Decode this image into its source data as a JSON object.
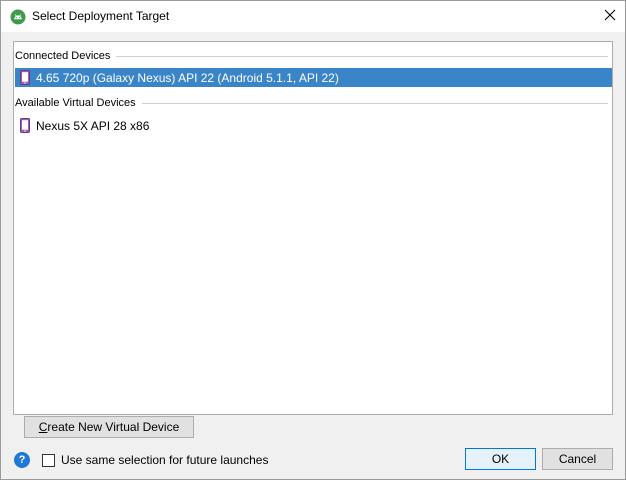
{
  "window": {
    "title": "Select Deployment Target",
    "app_icon": "android-studio-icon",
    "close_icon": "close-icon"
  },
  "device_list": {
    "sections": [
      {
        "header": "Connected Devices",
        "devices": [
          {
            "label": "4.65  720p (Galaxy Nexus) API 22 (Android 5.1.1, API 22)",
            "icon": "phone-icon",
            "selected": true
          }
        ]
      },
      {
        "header": "Available Virtual Devices",
        "devices": [
          {
            "label": "Nexus 5X API 28 x86",
            "icon": "phone-icon",
            "selected": false
          }
        ]
      }
    ]
  },
  "buttons": {
    "create_prefix": "C",
    "create_rest": "reate New Virtual Device",
    "ok": "OK",
    "cancel": "Cancel"
  },
  "footer": {
    "help_icon": "help-icon",
    "help_glyph": "?",
    "checkbox_label": "Use same selection for future launches",
    "checkbox_checked": false
  },
  "colors": {
    "selection": "#3a85c8",
    "device_icon": "#9a5fb5"
  }
}
